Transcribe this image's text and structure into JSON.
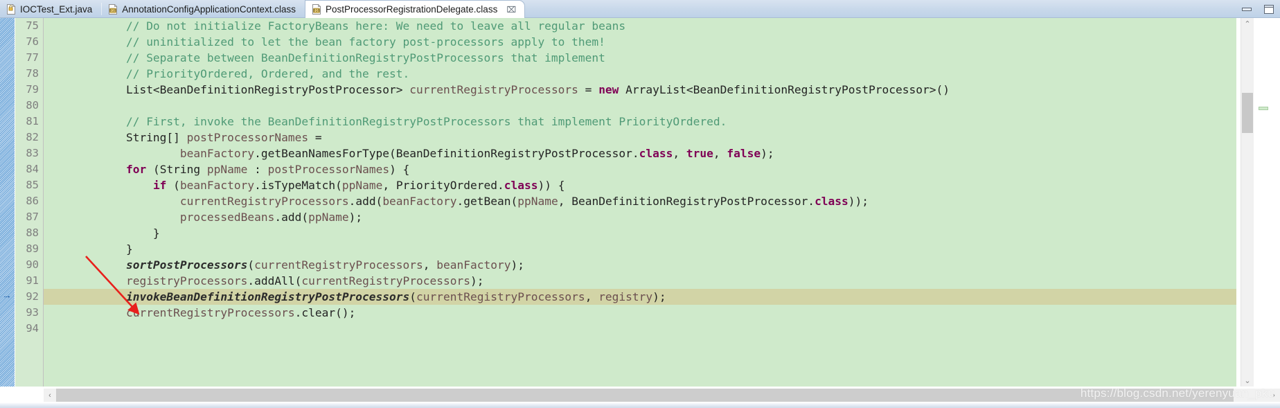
{
  "window": {
    "minimize_label": "Minimize",
    "maximize_label": "Maximize"
  },
  "tabs": [
    {
      "label": "IOCTest_Ext.java",
      "icon": "java-file-icon",
      "active": false,
      "closable": false
    },
    {
      "label": "AnnotationConfigApplicationContext.class",
      "icon": "class-file-icon",
      "active": false,
      "closable": false
    },
    {
      "label": "PostProcessorRegistrationDelegate.class",
      "icon": "class-file-icon",
      "active": true,
      "closable": true,
      "close_glyph": "⌧"
    }
  ],
  "editor": {
    "highlighted_line": 92,
    "first_line": 75,
    "colors": {
      "background": "#cfeacb",
      "gutter_background": "#d4ead0",
      "current_line": "#d2d4a6",
      "comment": "#4f9a76",
      "keyword": "#7f0055",
      "variable": "#6b4f4f",
      "plain": "#232323",
      "accent_arrow": "#e8201c"
    },
    "lines": [
      {
        "num": "75",
        "tokens": [
          {
            "t": "            ",
            "c": "plain"
          },
          {
            "t": "// Do not initialize FactoryBeans here: We need to leave all regular beans",
            "c": "com"
          }
        ]
      },
      {
        "num": "76",
        "tokens": [
          {
            "t": "            ",
            "c": "plain"
          },
          {
            "t": "// uninitialized to let the bean factory post-processors apply to them!",
            "c": "com"
          }
        ]
      },
      {
        "num": "77",
        "tokens": [
          {
            "t": "            ",
            "c": "plain"
          },
          {
            "t": "// Separate between BeanDefinitionRegistryPostProcessors that implement",
            "c": "com"
          }
        ]
      },
      {
        "num": "78",
        "tokens": [
          {
            "t": "            ",
            "c": "plain"
          },
          {
            "t": "// PriorityOrdered, Ordered, and the rest.",
            "c": "com"
          }
        ]
      },
      {
        "num": "79",
        "tokens": [
          {
            "t": "            ",
            "c": "plain"
          },
          {
            "t": "List<BeanDefinitionRegistryPostProcessor> ",
            "c": "plain"
          },
          {
            "t": "currentRegistryProcessors",
            "c": "var"
          },
          {
            "t": " = ",
            "c": "plain"
          },
          {
            "t": "new",
            "c": "kw"
          },
          {
            "t": " ArrayList<BeanDefinitionRegistryPostProcessor>()",
            "c": "plain"
          }
        ]
      },
      {
        "num": "80",
        "tokens": [
          {
            "t": "",
            "c": "plain"
          }
        ]
      },
      {
        "num": "81",
        "tokens": [
          {
            "t": "            ",
            "c": "plain"
          },
          {
            "t": "// First, invoke the BeanDefinitionRegistryPostProcessors that implement PriorityOrdered.",
            "c": "com"
          }
        ]
      },
      {
        "num": "82",
        "tokens": [
          {
            "t": "            ",
            "c": "plain"
          },
          {
            "t": "String[] ",
            "c": "plain"
          },
          {
            "t": "postProcessorNames",
            "c": "var"
          },
          {
            "t": " =",
            "c": "plain"
          }
        ]
      },
      {
        "num": "83",
        "tokens": [
          {
            "t": "                    ",
            "c": "plain"
          },
          {
            "t": "beanFactory",
            "c": "var"
          },
          {
            "t": ".getBeanNamesForType(BeanDefinitionRegistryPostProcessor.",
            "c": "plain"
          },
          {
            "t": "class",
            "c": "kw"
          },
          {
            "t": ", ",
            "c": "plain"
          },
          {
            "t": "true",
            "c": "kw"
          },
          {
            "t": ", ",
            "c": "plain"
          },
          {
            "t": "false",
            "c": "kw"
          },
          {
            "t": ");",
            "c": "plain"
          }
        ]
      },
      {
        "num": "84",
        "tokens": [
          {
            "t": "            ",
            "c": "plain"
          },
          {
            "t": "for",
            "c": "kw"
          },
          {
            "t": " (String ",
            "c": "plain"
          },
          {
            "t": "ppName",
            "c": "var"
          },
          {
            "t": " : ",
            "c": "plain"
          },
          {
            "t": "postProcessorNames",
            "c": "var"
          },
          {
            "t": ") {",
            "c": "plain"
          }
        ]
      },
      {
        "num": "85",
        "tokens": [
          {
            "t": "                ",
            "c": "plain"
          },
          {
            "t": "if",
            "c": "kw"
          },
          {
            "t": " (",
            "c": "plain"
          },
          {
            "t": "beanFactory",
            "c": "var"
          },
          {
            "t": ".isTypeMatch(",
            "c": "plain"
          },
          {
            "t": "ppName",
            "c": "var"
          },
          {
            "t": ", PriorityOrdered.",
            "c": "plain"
          },
          {
            "t": "class",
            "c": "kw"
          },
          {
            "t": ")) {",
            "c": "plain"
          }
        ]
      },
      {
        "num": "86",
        "tokens": [
          {
            "t": "                    ",
            "c": "plain"
          },
          {
            "t": "currentRegistryProcessors",
            "c": "var"
          },
          {
            "t": ".add(",
            "c": "plain"
          },
          {
            "t": "beanFactory",
            "c": "var"
          },
          {
            "t": ".getBean(",
            "c": "plain"
          },
          {
            "t": "ppName",
            "c": "var"
          },
          {
            "t": ", BeanDefinitionRegistryPostProcessor.",
            "c": "plain"
          },
          {
            "t": "class",
            "c": "kw"
          },
          {
            "t": "));",
            "c": "plain"
          }
        ]
      },
      {
        "num": "87",
        "tokens": [
          {
            "t": "                    ",
            "c": "plain"
          },
          {
            "t": "processedBeans",
            "c": "var"
          },
          {
            "t": ".add(",
            "c": "plain"
          },
          {
            "t": "ppName",
            "c": "var"
          },
          {
            "t": ");",
            "c": "plain"
          }
        ]
      },
      {
        "num": "88",
        "tokens": [
          {
            "t": "                }",
            "c": "plain"
          }
        ]
      },
      {
        "num": "89",
        "tokens": [
          {
            "t": "            }",
            "c": "plain"
          }
        ]
      },
      {
        "num": "90",
        "tokens": [
          {
            "t": "            ",
            "c": "plain"
          },
          {
            "t": "sortPostProcessors",
            "c": "italic"
          },
          {
            "t": "(",
            "c": "plain"
          },
          {
            "t": "currentRegistryProcessors",
            "c": "var"
          },
          {
            "t": ", ",
            "c": "plain"
          },
          {
            "t": "beanFactory",
            "c": "var"
          },
          {
            "t": ");",
            "c": "plain"
          }
        ]
      },
      {
        "num": "91",
        "tokens": [
          {
            "t": "            ",
            "c": "plain"
          },
          {
            "t": "registryProcessors",
            "c": "var"
          },
          {
            "t": ".addAll(",
            "c": "plain"
          },
          {
            "t": "currentRegistryProcessors",
            "c": "var"
          },
          {
            "t": ");",
            "c": "plain"
          }
        ]
      },
      {
        "num": "92",
        "tokens": [
          {
            "t": "            ",
            "c": "plain"
          },
          {
            "t": "invokeBeanDefinitionRegistryPostProcessors",
            "c": "italic"
          },
          {
            "t": "(",
            "c": "plain"
          },
          {
            "t": "currentRegistryProcessors",
            "c": "var"
          },
          {
            "t": ", ",
            "c": "plain"
          },
          {
            "t": "registry",
            "c": "var"
          },
          {
            "t": ");",
            "c": "plain"
          }
        ]
      },
      {
        "num": "93",
        "tokens": [
          {
            "t": "            ",
            "c": "plain"
          },
          {
            "t": "currentRegistryProcessors",
            "c": "var"
          },
          {
            "t": ".clear();",
            "c": "plain"
          }
        ]
      },
      {
        "num": "94",
        "tokens": [
          {
            "t": "",
            "c": "plain"
          }
        ]
      }
    ]
  },
  "scrollbars": {
    "vertical_up_glyph": "⌃",
    "vertical_down_glyph": "⌄",
    "horizontal_left_glyph": "‹",
    "horizontal_right_glyph": "›"
  },
  "watermark": {
    "text": "https://blog.csdn.net/yerenyuan_pku"
  }
}
